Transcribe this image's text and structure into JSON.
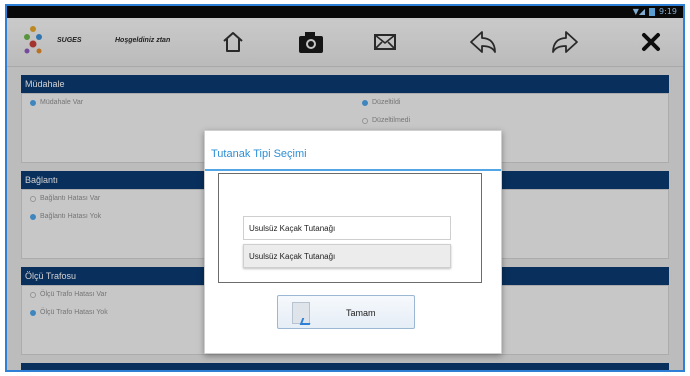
{
  "status_bar": {
    "time": "9:19"
  },
  "toolbar": {
    "brand": "SUGES",
    "welcome": "Hoşgeldiniz ztan",
    "buttons": [
      {
        "icon": "home-icon"
      },
      {
        "icon": "camera-icon"
      },
      {
        "icon": "mail-icon"
      },
      {
        "icon": "back-icon"
      },
      {
        "icon": "forward-icon"
      },
      {
        "icon": "close-icon"
      }
    ]
  },
  "sections": {
    "mudahale": {
      "title": "Müdahale",
      "options_left": [
        {
          "label": "Müdahale Var",
          "selected": true
        }
      ],
      "options_right": [
        {
          "label": "Düzeltildi",
          "selected": true
        },
        {
          "label": "Düzeltilmedi",
          "selected": false
        }
      ]
    },
    "baglanti": {
      "title": "Bağlantı",
      "options": [
        {
          "label": "Bağlantı Hatası Var",
          "selected": false
        },
        {
          "label": "Bağlantı Hatası Yok",
          "selected": true
        }
      ]
    },
    "olcu_trafosu": {
      "title": "Ölçü Trafosu",
      "options": [
        {
          "label": "Ölçü Trafo Hatası Var",
          "selected": false
        },
        {
          "label": "Ölçü Trafo Hatası Yok",
          "selected": true
        }
      ]
    }
  },
  "dialog": {
    "title": "Tutanak Tipi Seçimi",
    "items": [
      "Usulsüz Kaçak Tutanağı",
      "Usulsüz Kaçak Tutanağı"
    ],
    "ok_label": "Tamam"
  }
}
